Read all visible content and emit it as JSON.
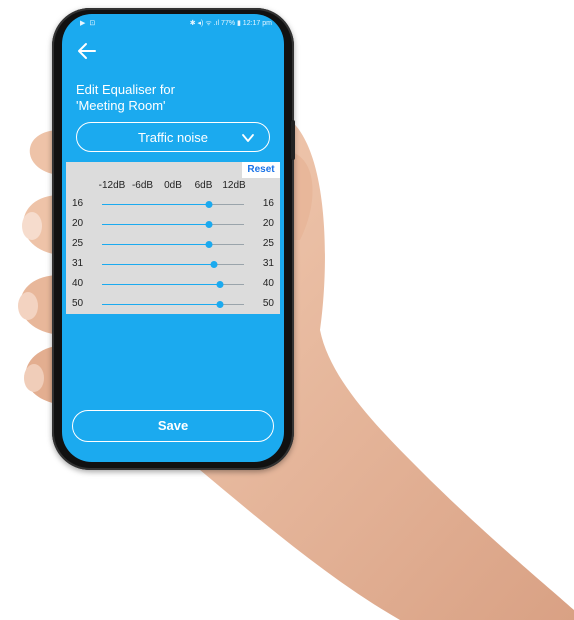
{
  "status_bar": {
    "left_icons": "▶ ⊡",
    "right": "✱ ◂) ᯤ .ıl 77% ▮ 12:17 pm"
  },
  "header": {
    "back_icon": "arrow-left-icon",
    "title_line1": "Edit Equaliser for",
    "title_line2": "'Meeting Room'"
  },
  "preset_dropdown": {
    "selected": "Traffic noise",
    "icon": "chevron-down-icon"
  },
  "equaliser": {
    "reset_label": "Reset",
    "db_scale": [
      "-12dB",
      "-6dB",
      "0dB",
      "6dB",
      "12dB"
    ],
    "range_db": [
      -12,
      12
    ],
    "bands": [
      {
        "label": "16",
        "gain_db": 6
      },
      {
        "label": "20",
        "gain_db": 6
      },
      {
        "label": "25",
        "gain_db": 6
      },
      {
        "label": "31",
        "gain_db": 7
      },
      {
        "label": "40",
        "gain_db": 8
      },
      {
        "label": "50",
        "gain_db": 8
      }
    ]
  },
  "footer": {
    "save_label": "Save"
  },
  "colors": {
    "accent": "#1baaef",
    "panel": "#dcdcdc",
    "reset_text": "#1a73e8"
  }
}
